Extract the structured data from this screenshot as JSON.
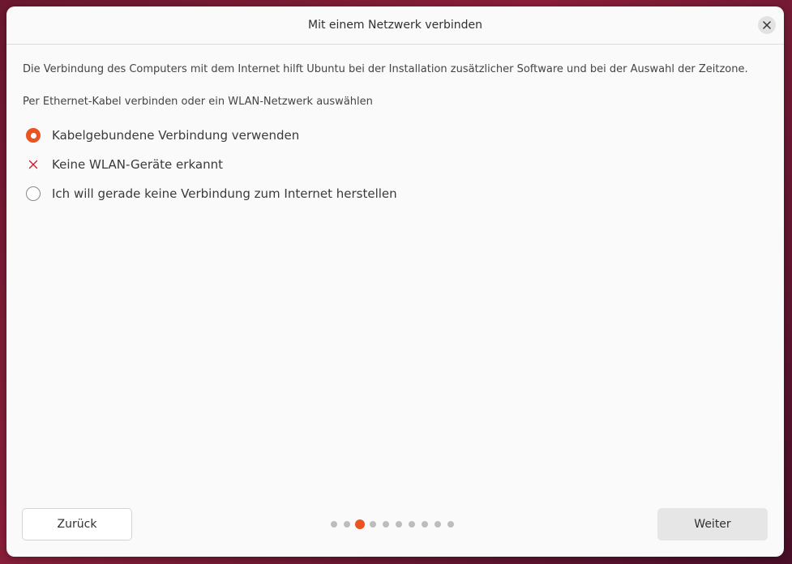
{
  "window": {
    "title": "Mit einem Netzwerk verbinden",
    "close_icon": "close-icon"
  },
  "main": {
    "description": "Die Verbindung des Computers mit dem Internet hilft Ubuntu bei der Installation zusätzlicher Software und bei der Auswahl der Zeitzone.",
    "instruction": "Per Ethernet-Kabel verbinden oder ein WLAN-Netzwerk auswählen",
    "options": [
      {
        "label": "Kabelgebundene Verbindung verwenden",
        "state": "selected"
      },
      {
        "label": "Keine WLAN-Geräte erkannt",
        "state": "unavailable",
        "icon": "x-icon"
      },
      {
        "label": "Ich will gerade keine Verbindung zum Internet herstellen",
        "state": "unselected"
      }
    ]
  },
  "footer": {
    "back_label": "Zurück",
    "next_label": "Weiter",
    "progress": {
      "current_step": 3,
      "total_steps": 10
    }
  },
  "colors": {
    "accent": "#e95420",
    "inactive_dot": "#bdbdbd",
    "error_x": "#c7162b"
  }
}
